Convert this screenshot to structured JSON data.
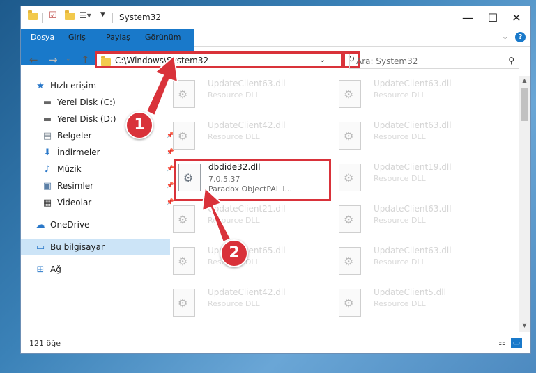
{
  "window": {
    "title": "System32",
    "controls": {
      "minimize": "—",
      "maximize": "☐",
      "close": "✕"
    }
  },
  "ribbon": {
    "tabs": [
      "Dosya",
      "Giriş",
      "Paylaş",
      "Görünüm"
    ],
    "help": "?"
  },
  "nav": {
    "address": "C:\\Windows\\System32",
    "search_placeholder": "Ara: System32"
  },
  "sidebar": {
    "items": [
      {
        "label": "Hızlı erişim",
        "icon": "star-icon"
      },
      {
        "label": "Yerel Disk (C:)",
        "icon": "drive-icon"
      },
      {
        "label": "Yerel Disk (D:)",
        "icon": "drive-icon"
      },
      {
        "label": "Belgeler",
        "icon": "documents-icon"
      },
      {
        "label": "İndirmeler",
        "icon": "download-icon"
      },
      {
        "label": "Müzik",
        "icon": "music-icon"
      },
      {
        "label": "Resimler",
        "icon": "pictures-icon"
      },
      {
        "label": "Videolar",
        "icon": "videos-icon"
      },
      {
        "label": "OneDrive",
        "icon": "cloud-icon"
      },
      {
        "label": "Bu bilgisayar",
        "icon": "computer-icon"
      },
      {
        "label": "Ağ",
        "icon": "network-icon"
      }
    ]
  },
  "files": {
    "left": [
      {
        "name": "UpdateClient63.dll",
        "type": "Resource DLL"
      },
      {
        "name": "UpdateClient42.dll",
        "type": "Resource DLL"
      },
      {
        "name": "dbdide32.dll",
        "version": "7.0.5.37",
        "type": "Paradox ObjectPAL I...",
        "selected": true
      },
      {
        "name": "UpdateClient21.dll",
        "type": "Resource DLL"
      },
      {
        "name": "UpdateClient65.dll",
        "type": "Resource DLL"
      },
      {
        "name": "UpdateClient42.dll",
        "type": "Resource DLL"
      }
    ],
    "right": [
      {
        "name": "UpdateClient63.dll",
        "type": "Resource DLL"
      },
      {
        "name": "UpdateClient63.dll",
        "type": "Resource DLL"
      },
      {
        "name": "UpdateClient19.dll",
        "type": "Resource DLL"
      },
      {
        "name": "UpdateClient63.dll",
        "type": "Resource DLL"
      },
      {
        "name": "UpdateClient63.dll",
        "type": "Resource DLL"
      },
      {
        "name": "UpdateClient5.dll",
        "type": "Resource DLL"
      }
    ]
  },
  "status": {
    "count": "121 öğe"
  },
  "annotations": {
    "step1": "1",
    "step2": "2"
  },
  "colors": {
    "accent": "#1979ca",
    "highlight": "#d9323a",
    "selected_nav": "#cce4f7"
  }
}
